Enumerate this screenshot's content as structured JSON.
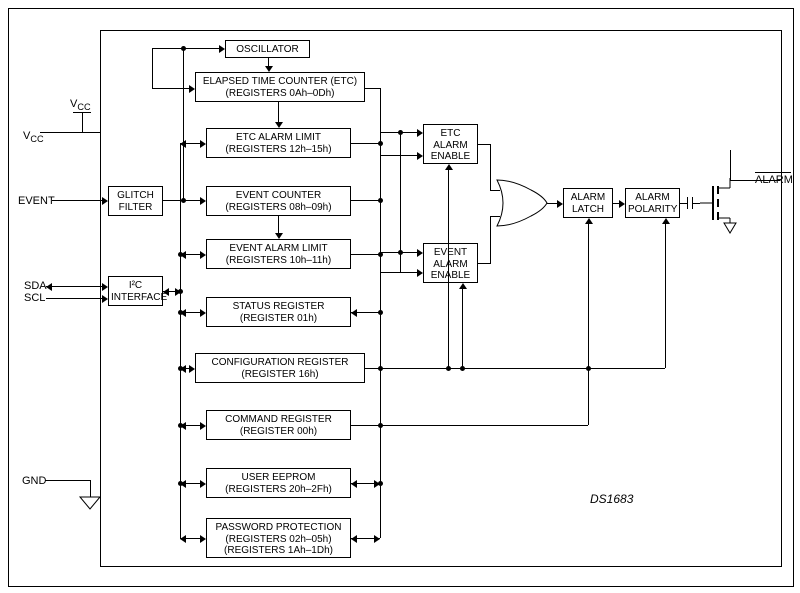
{
  "chip_name": "DS1683",
  "pins": {
    "vcc_sym": "V",
    "vcc_sub": "CC",
    "event": "EVENT",
    "sda": "SDA",
    "scl": "SCL",
    "gnd": "GND",
    "alarm": "ALARM"
  },
  "blocks": {
    "oscillator": "OSCILLATOR",
    "etc1": "ELAPSED TIME COUNTER (ETC)",
    "etc2": "(REGISTERS 0Ah–0Dh)",
    "etc_lim1": "ETC ALARM LIMIT",
    "etc_lim2": "(REGISTERS 12h–15h)",
    "evt_cnt1": "EVENT COUNTER",
    "evt_cnt2": "(REGISTERS 08h–09h)",
    "evt_lim1": "EVENT ALARM LIMIT",
    "evt_lim2": "(REGISTERS 10h–11h)",
    "status1": "STATUS REGISTER",
    "status2": "(REGISTER 01h)",
    "config1": "CONFIGURATION REGISTER",
    "config2": "(REGISTER 16h)",
    "cmd1": "COMMAND REGISTER",
    "cmd2": "(REGISTER 00h)",
    "eeprom1": "USER EEPROM",
    "eeprom2": "(REGISTERS 20h–2Fh)",
    "pwd1": "PASSWORD PROTECTION",
    "pwd2": "(REGISTERS 02h–05h)",
    "pwd3": "(REGISTERS 1Ah–1Dh)",
    "glitch1": "GLITCH",
    "glitch2": "FILTER",
    "i2c1": "I²C",
    "i2c2": "INTERFACE",
    "etc_en1": "ETC",
    "etc_en2": "ALARM",
    "etc_en3": "ENABLE",
    "evt_en1": "EVENT",
    "evt_en2": "ALARM",
    "evt_en3": "ENABLE",
    "latch1": "ALARM",
    "latch2": "LATCH",
    "pol1": "ALARM",
    "pol2": "POLARITY"
  }
}
